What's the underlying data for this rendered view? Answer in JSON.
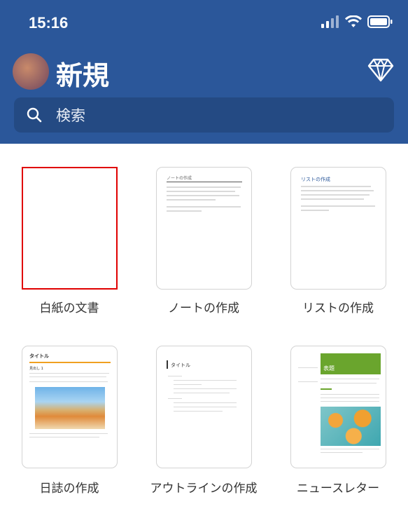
{
  "status_bar": {
    "time": "15:16",
    "icons": [
      "signal-icon",
      "wifi-icon",
      "battery-icon"
    ]
  },
  "header": {
    "title": "新規",
    "premium_icon": "diamond-icon"
  },
  "search": {
    "placeholder": "検索"
  },
  "templates": [
    {
      "label": "白紙の文書",
      "selected": true
    },
    {
      "label": "ノートの作成"
    },
    {
      "label": "リストの作成"
    },
    {
      "label": "日誌の作成"
    },
    {
      "label": "アウトラインの作成"
    },
    {
      "label": "ニュースレター"
    }
  ],
  "thumbnails": {
    "note": {
      "title": "ノートの作成"
    },
    "list": {
      "title": "リストの作成"
    },
    "diary": {
      "title": "タイトル",
      "subtitle": "見出し 1"
    },
    "outline": {
      "title": "タイトル"
    },
    "newsletter": {
      "title": "表題"
    }
  },
  "colors": {
    "header": "#2b579a",
    "selection": "#e00000",
    "accent_diary": "#f0a020",
    "accent_newsletter": "#6aa52d"
  }
}
